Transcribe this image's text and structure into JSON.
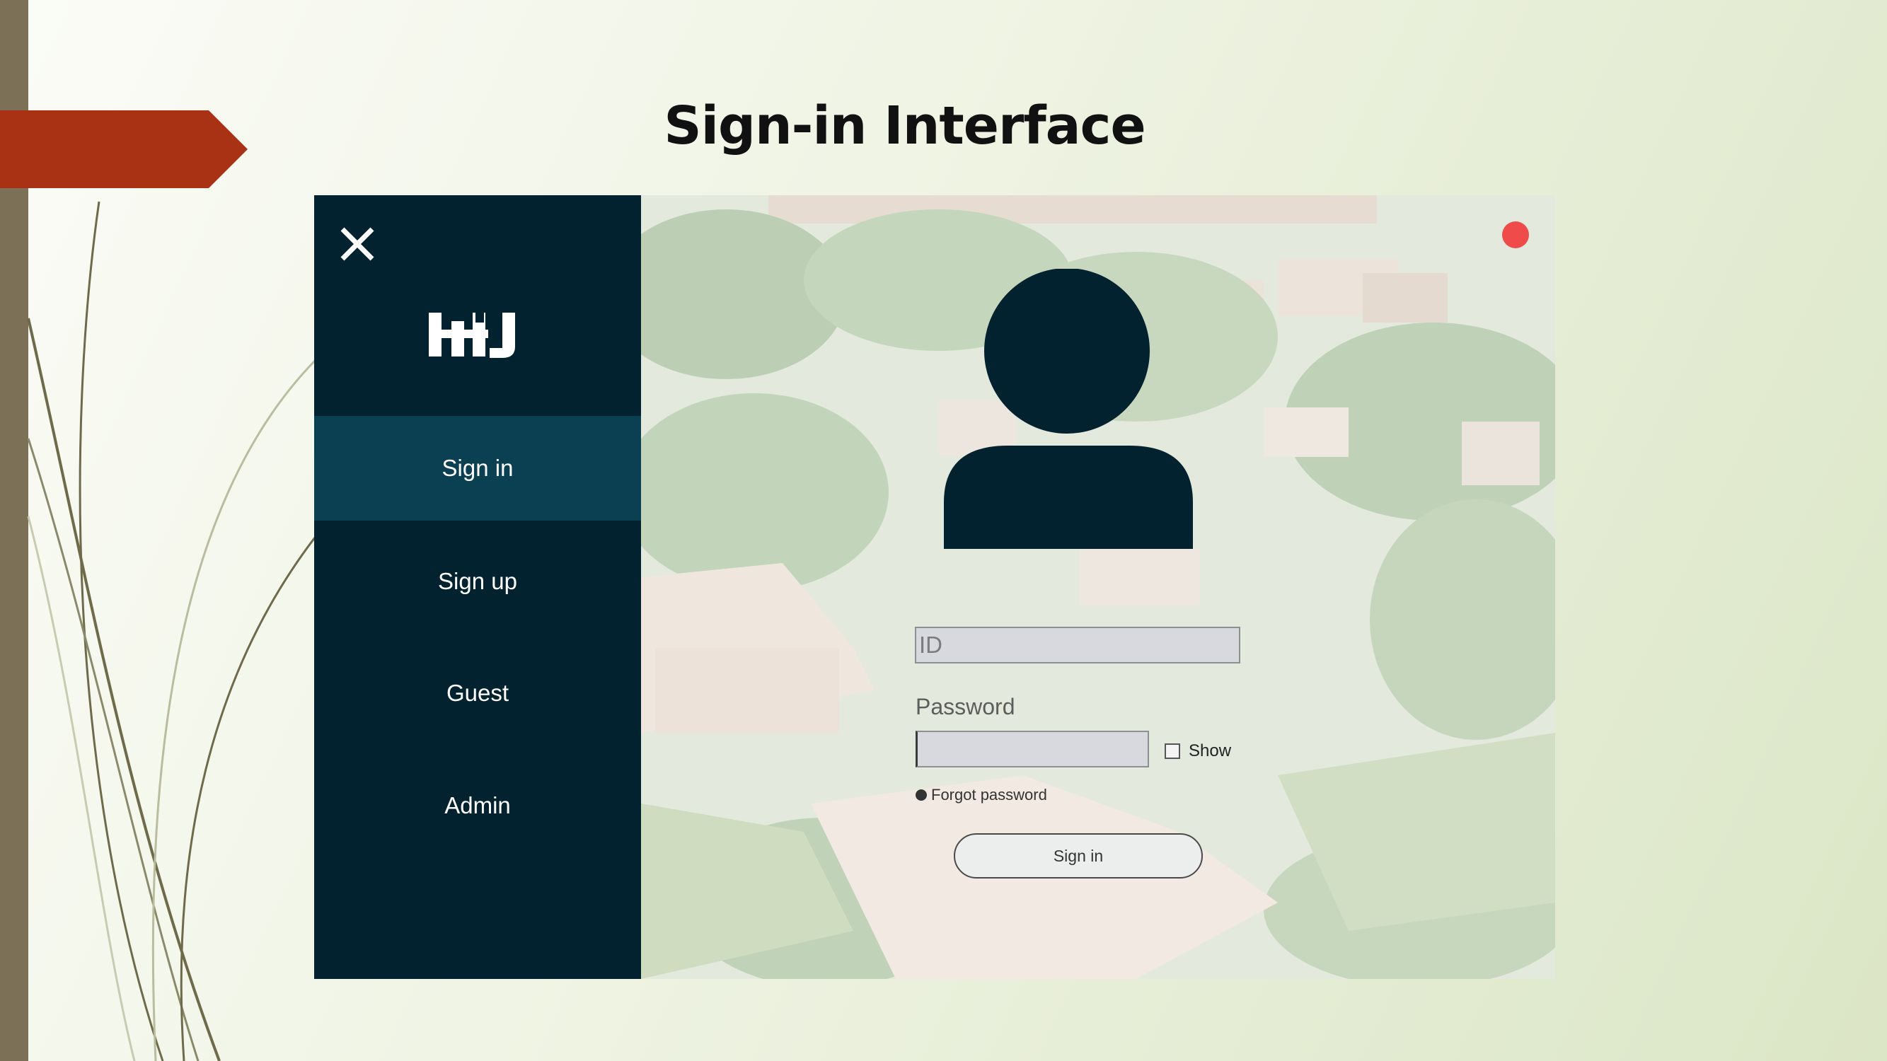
{
  "slide": {
    "title": "Sign-in Interface"
  },
  "colors": {
    "sidebar_bg": "#032230",
    "sidebar_active": "#0b4053",
    "accent_banner": "#a93215",
    "record_dot": "#ef4b4b",
    "avatar_fill": "#032230"
  },
  "sidebar": {
    "close_icon": "close-icon",
    "logo_text": "HHJ",
    "items": [
      {
        "label": "Sign in",
        "active": true
      },
      {
        "label": "Sign up",
        "active": false
      },
      {
        "label": "Guest",
        "active": false
      },
      {
        "label": "Admin",
        "active": false
      }
    ]
  },
  "form": {
    "avatar_icon": "user-avatar-icon",
    "id_placeholder": "ID",
    "password_label": "Password",
    "show_label": "Show",
    "forgot_label": "Forgot password",
    "submit_label": "Sign in"
  }
}
